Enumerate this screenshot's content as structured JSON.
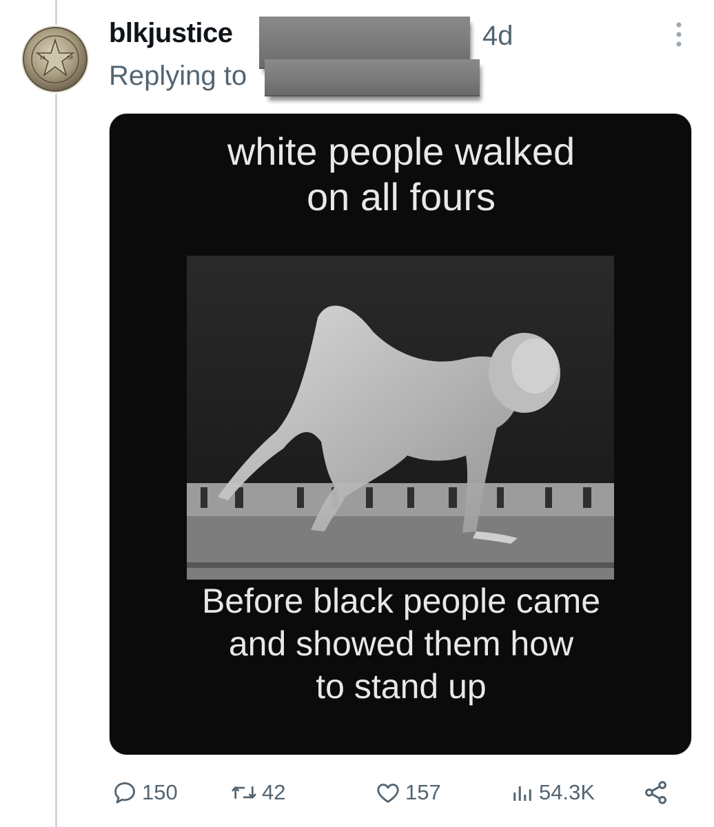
{
  "tweet": {
    "username": "blkjustice",
    "timestamp": "4d",
    "replying_to_label": "Replying to",
    "avatar_icon": "badge-icon",
    "more_icon": "more-icon"
  },
  "meme": {
    "top_caption": "white people walked\non all fours",
    "bottom_caption": "Before black people came\nand showed them how\nto stand up"
  },
  "actions": {
    "replies": "150",
    "retweets": "42",
    "likes": "157",
    "views": "54.3K"
  },
  "colors": {
    "muted_text": "#536471",
    "thread_line": "#cfd9de",
    "redaction": "#7a7a7a"
  }
}
